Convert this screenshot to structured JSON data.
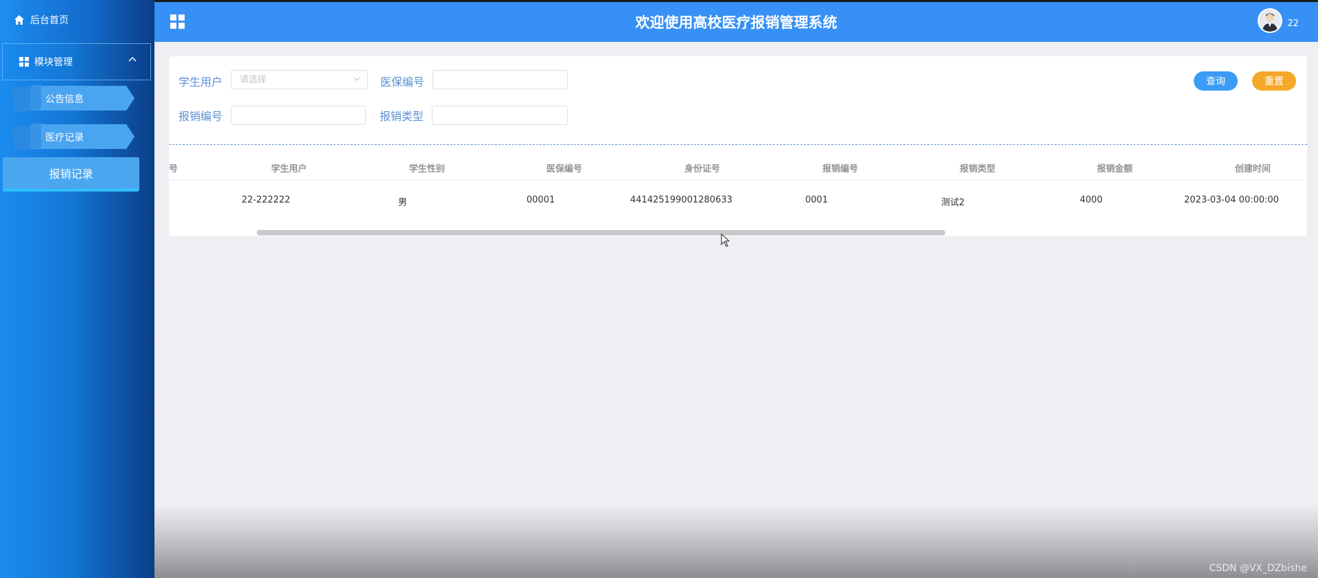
{
  "app": {
    "title": "欢迎使用高校医疗报销管理系统"
  },
  "user": {
    "name": "22"
  },
  "sidebar": {
    "home_label": "后台首页",
    "group_label": "模块管理",
    "items": [
      {
        "label": "公告信息"
      },
      {
        "label": "医疗记录"
      },
      {
        "label": "报销记录"
      }
    ]
  },
  "search": {
    "fields": [
      {
        "label": "学生用户",
        "placeholder": "请选择",
        "value": ""
      },
      {
        "label": "医保编号",
        "placeholder": "",
        "value": ""
      },
      {
        "label": "报销编号",
        "placeholder": "",
        "value": ""
      },
      {
        "label": "报销类型",
        "placeholder": "",
        "value": ""
      }
    ],
    "query_label": "查询",
    "reset_label": "重置"
  },
  "table": {
    "partial_header": "号",
    "columns": [
      "学生用户",
      "学生性别",
      "医保编号",
      "身份证号",
      "报销编号",
      "报销类型",
      "报销金额",
      "创建时间"
    ],
    "rows": [
      [
        "22-222222",
        "男",
        "00001",
        "441425199001280633",
        "0001",
        "测试2",
        "4000",
        "2023-03-04 00:00:00"
      ]
    ]
  },
  "watermark": "CSDN @VX_DZbishe",
  "colors": {
    "header": "#3790f6",
    "sidebar_active": "#4aa7ef",
    "query_button": "#3a9cf5",
    "reset_button": "#f5a72a",
    "label": "#5d8fd6"
  }
}
